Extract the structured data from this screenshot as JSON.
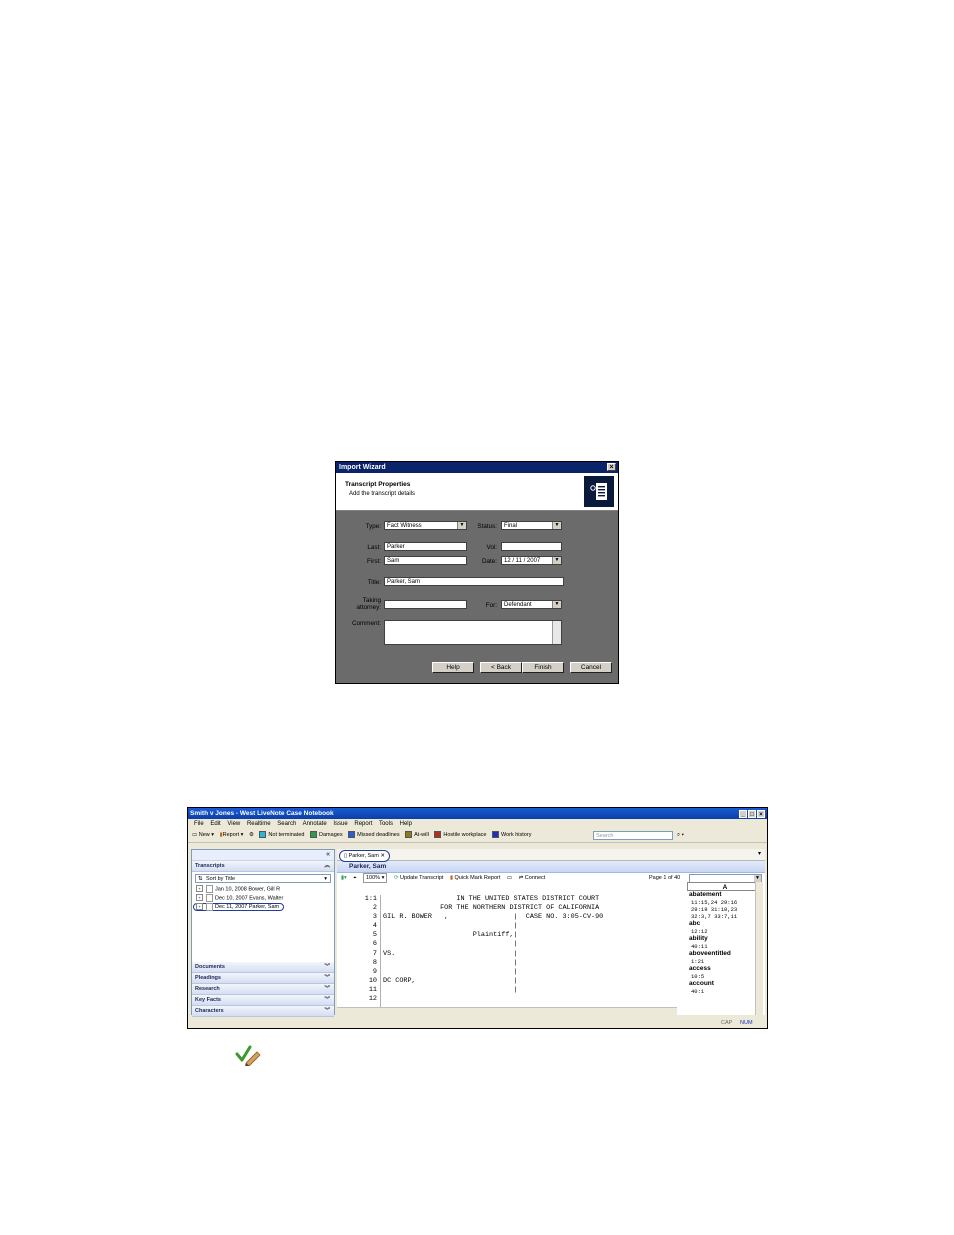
{
  "wizard": {
    "title": "Import Wizard",
    "close": "×",
    "heading": "Transcript Properties",
    "subheading": "Add the transcript details",
    "type_label": "Type:",
    "type_value": "Fact Witness",
    "status_label": "Status:",
    "status_value": "Final",
    "last_label": "Last:",
    "last_value": "Parker",
    "vol_label": "Vol:",
    "vol_value": "",
    "first_label": "First:",
    "first_value": "Sam",
    "date_label": "Date:",
    "date_value": "12 / 11 / 2007",
    "title_label": "Title:",
    "title_value": "Parker, Sam",
    "taking_label_1": "Taking",
    "taking_label_2": "attorney:",
    "taking_value": "",
    "for_label": "For:",
    "for_value": "Defendant",
    "comment_label": "Comment:",
    "comment_value": "",
    "buttons": {
      "help": "Help",
      "back": "< Back",
      "finish": "Finish",
      "cancel": "Cancel"
    }
  },
  "app": {
    "title": "Smith v Jones - West LiveNote Case Notebook",
    "menu": [
      "File",
      "Edit",
      "View",
      "Realtime",
      "Search",
      "Annotate",
      "Issue",
      "Report",
      "Tools",
      "Help"
    ],
    "toolbar": {
      "new": "New",
      "report": "Report",
      "issues": [
        {
          "label": "Not terminated",
          "color": "#2ab7d6"
        },
        {
          "label": "Damages",
          "color": "#2e9b4b"
        },
        {
          "label": "Missed deadlines",
          "color": "#2d5bd1"
        },
        {
          "label": "At-will",
          "color": "#8a7a20"
        },
        {
          "label": "Hostile workplace",
          "color": "#b0301f"
        },
        {
          "label": "Work history",
          "color": "#1f2fbd"
        }
      ],
      "search_placeholder": "Search"
    },
    "left_pane": {
      "collapse": "«",
      "transcripts_header": "Transcripts",
      "sort_label": "Sort by Title",
      "transcripts": [
        "Jan 10, 2008  Bower, Gill R",
        "Dec 10, 2007  Evans, Walter",
        "Dec 11, 2007  Parker, Sam"
      ],
      "sections": [
        "Documents",
        "Pleadings",
        "Research",
        "Key Facts",
        "Characters"
      ]
    },
    "main": {
      "tab": "Parker, Sam",
      "doc_title": "Parker, Sam",
      "zoom": "100%",
      "update_transcript": "Update Transcript",
      "quick_mark_report": "Quick Mark Report",
      "connect": "Connect",
      "page_info": "Page 1 of 40",
      "transcript_lines": [
        {
          "n": "1:1",
          "t": "                  IN THE UNITED STATES DISTRICT COURT"
        },
        {
          "n": "2",
          "t": "              FOR THE NORTHERN DISTRICT OF CALIFORNIA"
        },
        {
          "n": "3",
          "t": "GIL R. BOWER   ,                |  CASE NO. 3:05-CV-90"
        },
        {
          "n": "4",
          "t": "                                |"
        },
        {
          "n": "5",
          "t": "                      Plaintiff,|"
        },
        {
          "n": "6",
          "t": "                                |"
        },
        {
          "n": "7",
          "t": "VS.                             |"
        },
        {
          "n": "8",
          "t": "                                |"
        },
        {
          "n": "9",
          "t": "                                |"
        },
        {
          "n": "10",
          "t": "DC CORP,                        |"
        },
        {
          "n": "11",
          "t": "                                |"
        },
        {
          "n": "12",
          "t": ""
        }
      ],
      "index_header": "A",
      "index": [
        {
          "word": "abatement",
          "refs": [
            "11:15,24 29:16",
            "29:19 31:18,23",
            "32:3,7 33:7,11"
          ]
        },
        {
          "word": "abc",
          "refs": [
            "12:12"
          ]
        },
        {
          "word": "ability",
          "refs": [
            "40:11"
          ]
        },
        {
          "word": "aboveentitled",
          "refs": [
            "1:21"
          ]
        },
        {
          "word": "access",
          "refs": [
            "10:5"
          ]
        },
        {
          "word": "account",
          "refs": [
            "40:1"
          ]
        }
      ]
    },
    "status": {
      "cap": "CAP",
      "num": "NUM"
    }
  }
}
